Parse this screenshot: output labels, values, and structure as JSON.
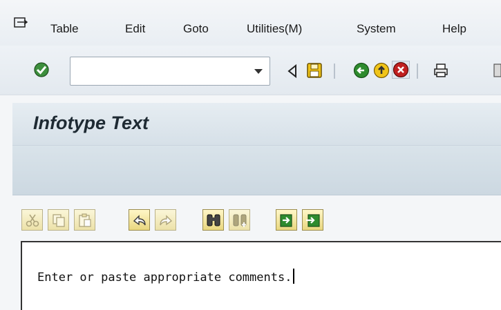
{
  "menu": {
    "icon": "menu-arrow-icon",
    "items": [
      {
        "label": "Table"
      },
      {
        "label": "Edit"
      },
      {
        "label": "Goto"
      },
      {
        "label": "Utilities(M)"
      },
      {
        "label": "System"
      },
      {
        "label": "Help"
      }
    ]
  },
  "toolbar": {
    "command_field_value": "",
    "icons": [
      "enter-check-icon",
      "back-arrow-icon",
      "save-icon",
      "back-icon",
      "exit-icon",
      "cancel-icon",
      "print-icon"
    ]
  },
  "title": "Infotype Text",
  "editor_toolbar": {
    "icons": [
      "cut-icon",
      "copy-icon",
      "paste-icon",
      "undo-icon",
      "redo-icon",
      "find-icon",
      "find-next-icon",
      "import-icon",
      "export-icon"
    ]
  },
  "editor": {
    "text": "Enter or paste appropriate comments."
  },
  "colors": {
    "accent_green": "#2e8b2e",
    "accent_red": "#c02020",
    "save_yellow": "#f0c419",
    "button_yellow": "#e9d77f"
  }
}
